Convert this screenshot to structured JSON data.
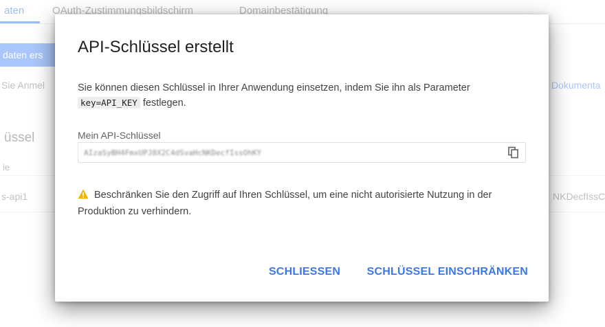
{
  "background": {
    "tabs": [
      {
        "label": "aten",
        "active": true
      },
      {
        "label": "OAuth-Zustimmungsbildschirm",
        "active": false
      },
      {
        "label": "Domainbestätigung",
        "active": false
      }
    ],
    "create_button": "daten ers",
    "hint_text": "Sie Anmel",
    "docs_link": "Dokumenta",
    "section_title": "üssel",
    "column_header": "ie",
    "row_name": "s-api1",
    "row_key": "NKDecfIssC"
  },
  "dialog": {
    "title": "API-Schlüssel erstellt",
    "description_before": "Sie können diesen Schlüssel in Ihrer Anwendung einsetzen, indem Sie ihn als Parameter",
    "description_code": "key=API_KEY",
    "description_after": "festlegen.",
    "key_label": "Mein API-Schlüssel",
    "key_value": "AIzaSyBH4FmxUPJ8X2C4dSvaHcNKDecfIssOhKY",
    "copy_icon": "copy-icon",
    "warning_icon": "warning-triangle-icon",
    "warning_text": "Beschränken Sie den Zugriff auf Ihren Schlüssel, um eine nicht autorisierte Nutzung in der Produktion zu verhindern.",
    "close_button": "SCHLIESSEN",
    "restrict_button": "SCHLÜSSEL EINSCHRÄNKEN"
  },
  "colors": {
    "accent": "#3b78e7",
    "warning": "#f4b400"
  }
}
